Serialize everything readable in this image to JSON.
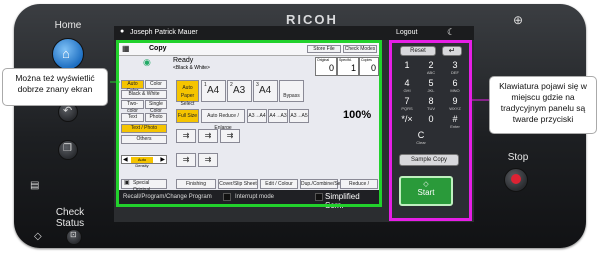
{
  "device": {
    "brand": "RICOH",
    "home_label": "Home",
    "stop_label": "Stop",
    "check_status_label": "Check\nStatus"
  },
  "screen": {
    "user": "Joseph Patrick Mauer",
    "logout": "Logout",
    "app_title": "Copy",
    "store_file": "Store File",
    "check_modes": "Check Modes",
    "status": "Ready",
    "status_sub": "<Black & White>",
    "originals_label": "Original",
    "originals_value": "0",
    "specified_label": "Specifd.",
    "specified_value": "1",
    "copies_label": "Copies",
    "copies_value": "0",
    "color_modes": [
      "Auto Color",
      "Color",
      "Black & White",
      "Two-color",
      "Single Color"
    ],
    "original_types": [
      "Text",
      "Photo",
      "Text / Photo",
      "Others"
    ],
    "density_label": "Auto Density",
    "paper": {
      "auto": "Auto Paper Select",
      "trays": [
        "A4",
        "A3",
        "A4"
      ],
      "tray_nums": [
        "1",
        "2",
        "3"
      ],
      "bypass": "Bypass"
    },
    "reduce": {
      "full_size": "Full Size",
      "auto_reduce": "Auto Reduce / Enlarge",
      "zoom": "100%",
      "presets": [
        "A3→A4",
        "A4→A3",
        "A3→A5"
      ]
    },
    "special_original": "Special Original",
    "bottom_tabs": [
      "Finishing",
      "Cover/Slip Sheet",
      "Edit / Colour",
      "Dup./Combine/Series",
      "Reduce / Enlarge"
    ],
    "recall_bar": "Recall/Program/Change Program",
    "interrupt": "Interrupt mode",
    "simplified": "Simplified Scrn."
  },
  "keypad": {
    "reset": "Reset",
    "keys": [
      {
        "n": "1",
        "s": ""
      },
      {
        "n": "2",
        "s": "ABC"
      },
      {
        "n": "3",
        "s": "DEF"
      },
      {
        "n": "4",
        "s": "GHI"
      },
      {
        "n": "5",
        "s": "JKL"
      },
      {
        "n": "6",
        "s": "MNO"
      },
      {
        "n": "7",
        "s": "PQRS"
      },
      {
        "n": "8",
        "s": "TUV"
      },
      {
        "n": "9",
        "s": "WXYZ"
      },
      {
        "n": "*/×",
        "s": ""
      },
      {
        "n": "0",
        "s": ""
      },
      {
        "n": "#",
        "s": "Enter"
      }
    ],
    "clear": "C",
    "clear_sub": "Clear",
    "sample_copy": "Sample Copy",
    "start": "Start"
  },
  "callouts": {
    "left": "Można też wyświetlić dobrze znany ekran",
    "right": "Klawiatura pojawi się w miejscu gdzie na tradycyjnym panelu są twarde przyciski"
  }
}
